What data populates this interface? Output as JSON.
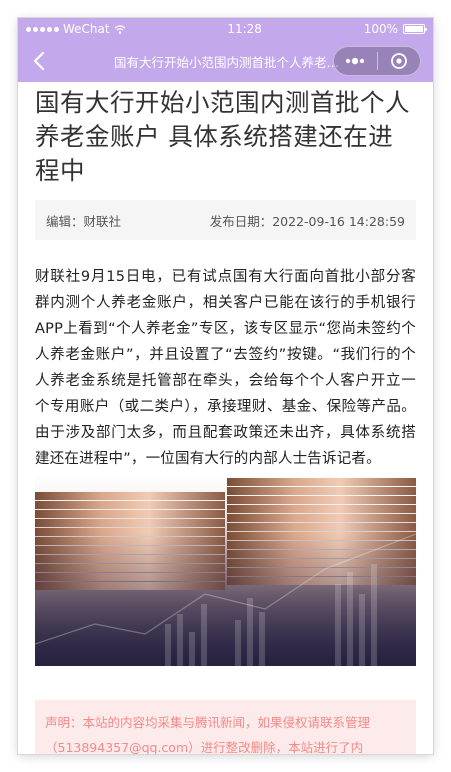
{
  "status_bar": {
    "carrier": "WeChat",
    "time": "11:28",
    "battery": "100%"
  },
  "nav": {
    "title": "国有大行开始小范围内测首批个人养老金账户 具体系统搭建还在进程中"
  },
  "article": {
    "title": "国有大行开始小范围内测首批个人养老金账户 具体系统搭建还在进程中",
    "editor": "编辑：财联社",
    "publish_date": "发布日期：2022-09-16 14:28:59",
    "body": "财联社9月15日电，已有试点国有大行面向首批小部分客群内测个人养老金账户，相关客户已能在该行的手机银行APP上看到“个人养老金”专区，该专区显示“您尚未签约个人养老金账户”，并且设置了“去签约”按键。“我们行的个人养老金系统是托管部在牵头，会给每个个人客户开立一个专用账户（或二类户），承接理财、基金、保险等产品。由于涉及部门太多，而且配套政策还未出齐，具体系统搭建还在进程中”，一位国有大行的内部人士告诉记者。",
    "notice": "声明：本站的内容均采集与腾讯新闻，如果侵权请联系管理（513894357@qq.com）进行整改删除，本站进行了内"
  }
}
